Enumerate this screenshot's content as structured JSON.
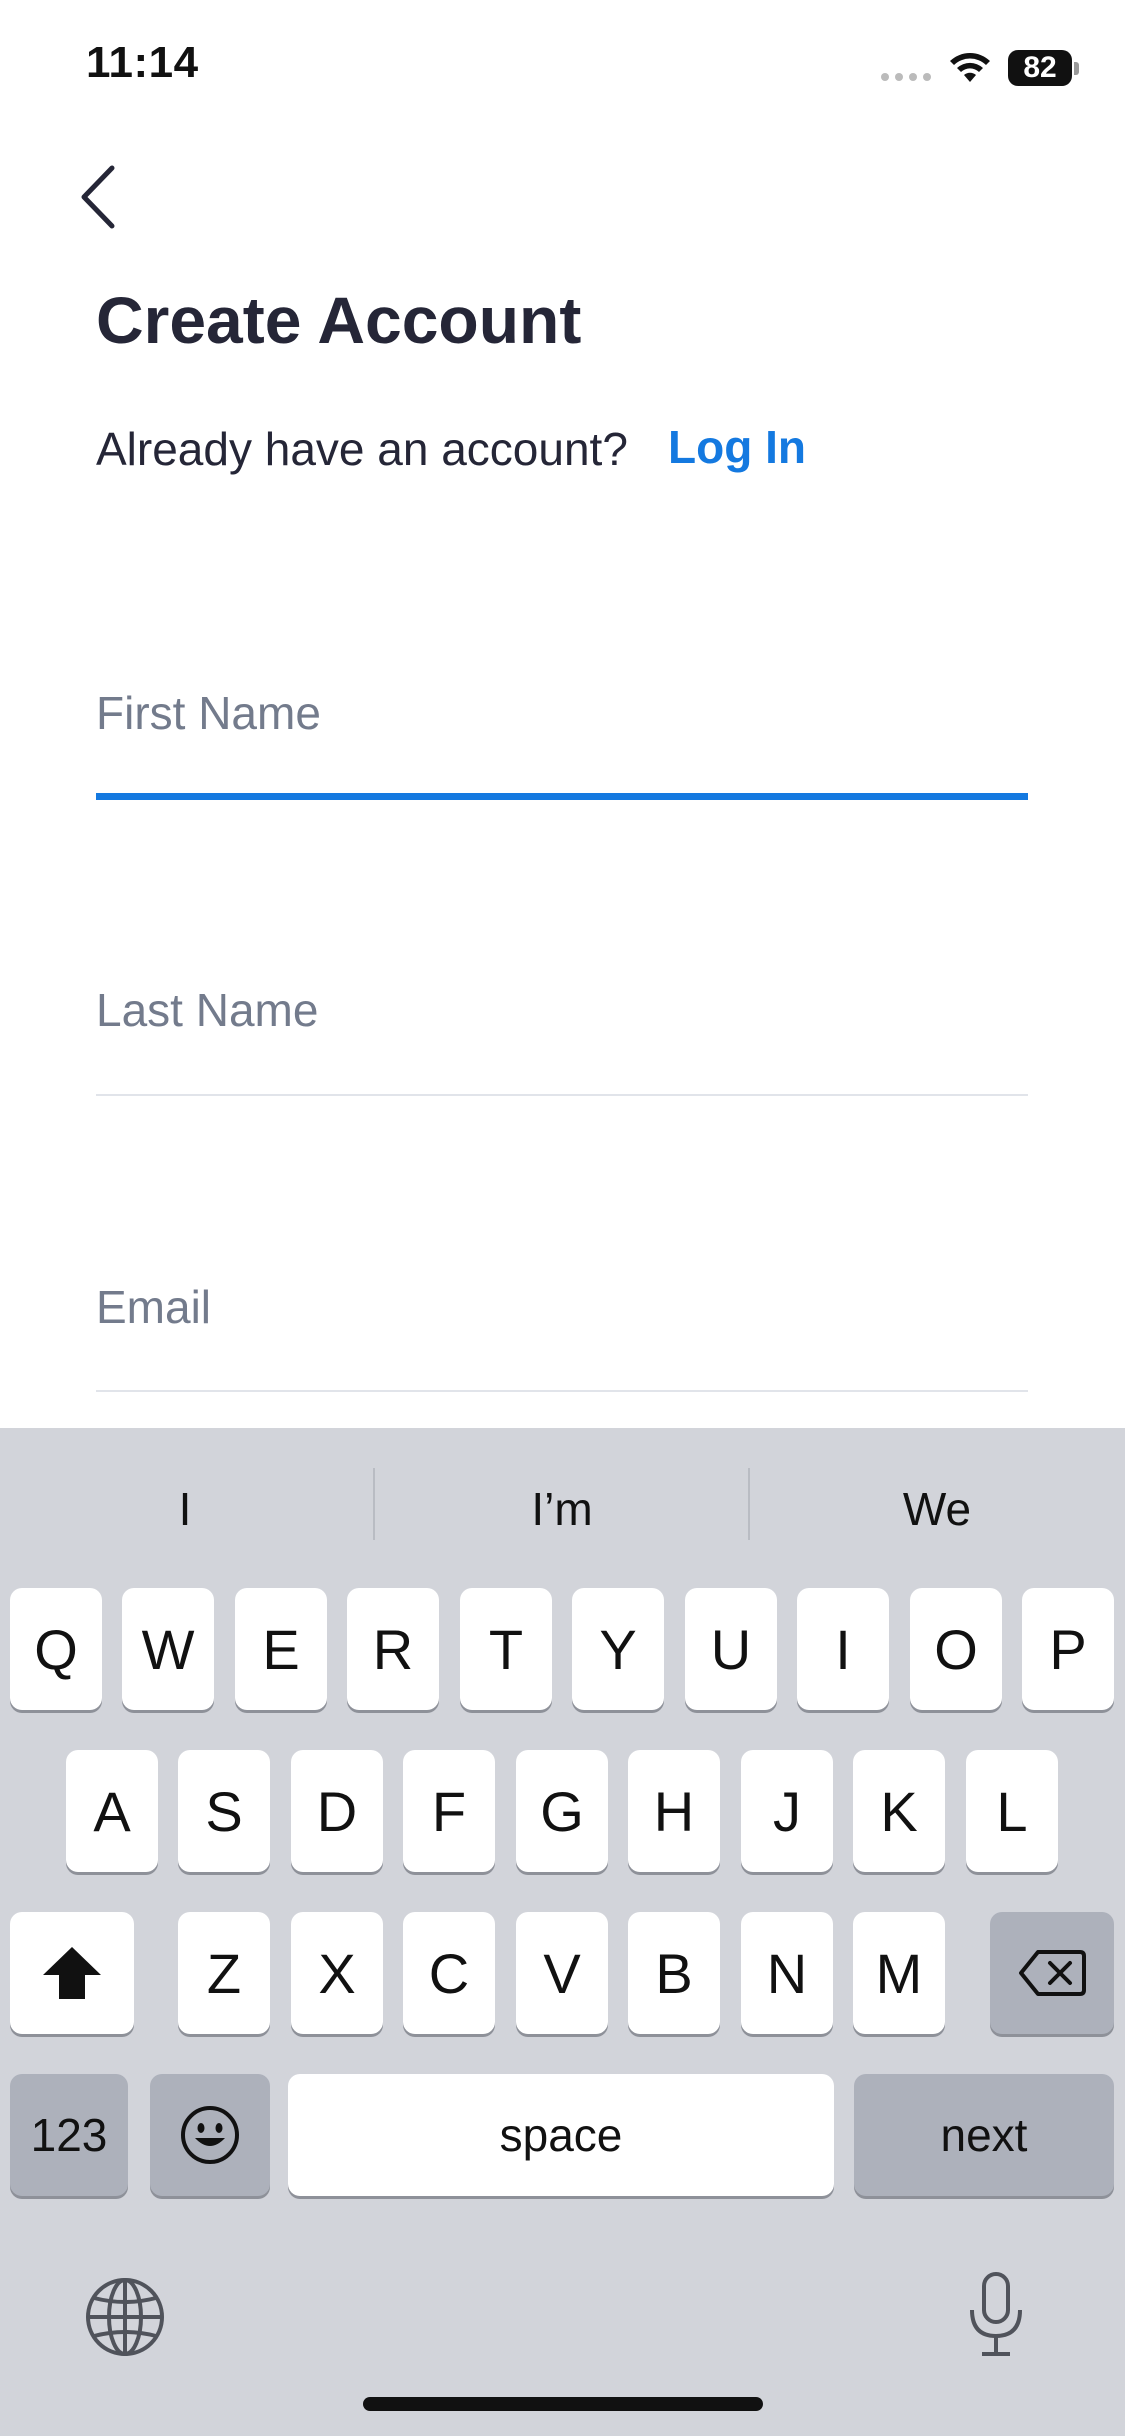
{
  "status_bar": {
    "time": "11:14",
    "battery": "82",
    "icons": [
      "signal-dots-icon",
      "wifi-icon",
      "battery-icon"
    ]
  },
  "header": {
    "back_icon": "chevron-left-icon",
    "title": "Create Account",
    "subtitle": "Already have an account?",
    "login_link": "Log In"
  },
  "form": {
    "first_name_placeholder": "First Name",
    "last_name_placeholder": "Last Name",
    "email_placeholder": "Email",
    "active_field": "First Name"
  },
  "keyboard": {
    "suggestions": [
      "I",
      "I’m",
      "We"
    ],
    "row1": [
      "Q",
      "W",
      "E",
      "R",
      "T",
      "Y",
      "U",
      "I",
      "O",
      "P"
    ],
    "row2": [
      "A",
      "S",
      "D",
      "F",
      "G",
      "H",
      "J",
      "K",
      "L"
    ],
    "row3": [
      "Z",
      "X",
      "C",
      "V",
      "B",
      "N",
      "M"
    ],
    "numbers_key": "123",
    "space_key": "space",
    "return_key": "next",
    "icons": [
      "shift-icon",
      "delete-icon",
      "emoji-icon",
      "globe-icon",
      "microphone-icon"
    ]
  },
  "colors": {
    "accent": "#1479e0",
    "title": "#252637",
    "placeholder": "#737b8c",
    "keyboard_bg": "#d2d4da"
  }
}
